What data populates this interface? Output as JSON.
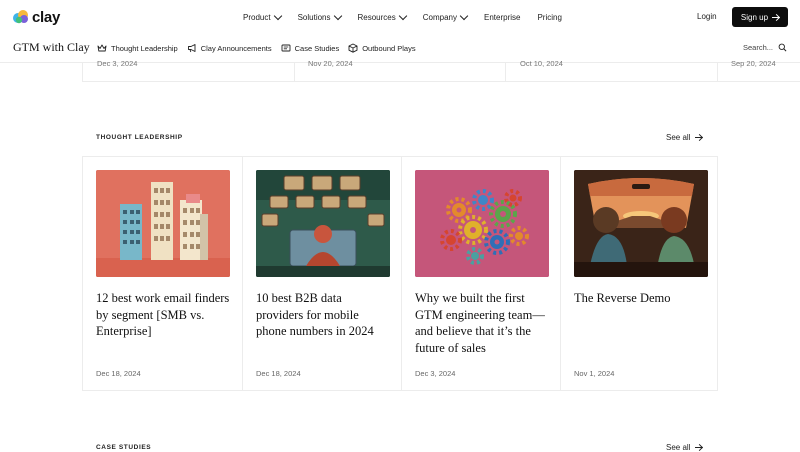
{
  "brand": {
    "word": "clay"
  },
  "nav": {
    "links": [
      "Product",
      "Solutions",
      "Resources",
      "Company",
      "Enterprise",
      "Pricing"
    ],
    "login": "Login",
    "signup": "Sign up"
  },
  "subnav": {
    "title": "GTM with Clay",
    "items": [
      "Thought Leadership",
      "Clay Announcements",
      "Case Studies",
      "Outbound Plays"
    ],
    "search": "Search..."
  },
  "previous_row": {
    "dates": [
      "Dec 3, 2024",
      "Nov 20, 2024",
      "Oct 10, 2024",
      "Sep 20, 2024"
    ]
  },
  "thought_leadership": {
    "label": "THOUGHT LEADERSHIP",
    "see_all": "See all",
    "cards": [
      {
        "title": "12 best work email finders by segment [SMB vs. Enterprise]",
        "date": "Dec 18, 2024"
      },
      {
        "title": "10 best B2B data providers for mobile phone numbers in 2024",
        "date": "Dec 18, 2024"
      },
      {
        "title": "Why we built the first GTM engineering team—and believe that it’s the future of sales",
        "date": "Dec 3, 2024"
      },
      {
        "title": "The Reverse Demo",
        "date": "Nov 1, 2024"
      }
    ]
  },
  "case_studies": {
    "label": "CASE STUDIES",
    "see_all": "See all"
  },
  "colors": {
    "card1_bg": "#e0715f",
    "card2_bg": "#2e5a4a",
    "card3_bg": "#c5567a",
    "card4_bg": "#3a2418",
    "button": "#0d0d0d"
  }
}
